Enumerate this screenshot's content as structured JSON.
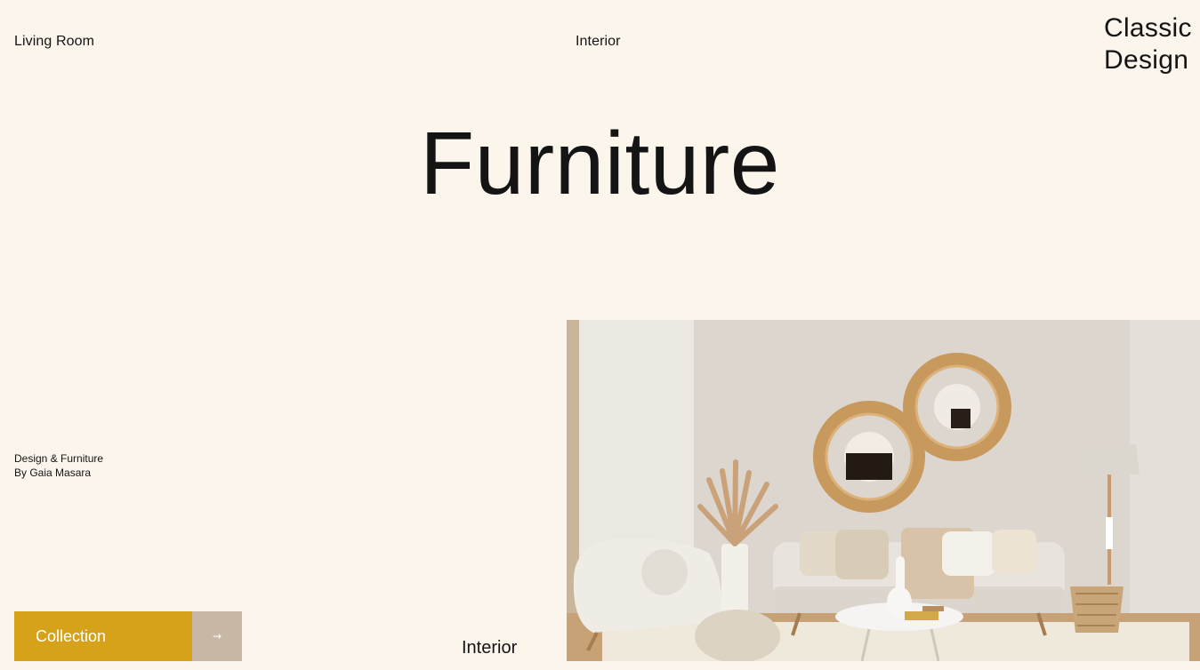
{
  "nav": {
    "left_link": "Living Room",
    "center_link": "Interior"
  },
  "brand": {
    "line1": "Classic",
    "line2": "Design"
  },
  "hero": {
    "title": "Furniture"
  },
  "credit": {
    "line1": "Design & Furniture",
    "line2": "By Gaia Masara"
  },
  "cta": {
    "label": "Collection",
    "arrow": "→"
  },
  "footer": {
    "label": "Interior"
  },
  "colors": {
    "background": "#fcf5eb",
    "accent": "#d6a219",
    "arrow_button": "#c6b8a5"
  },
  "photo": {
    "semantic": "living-room-photo"
  }
}
